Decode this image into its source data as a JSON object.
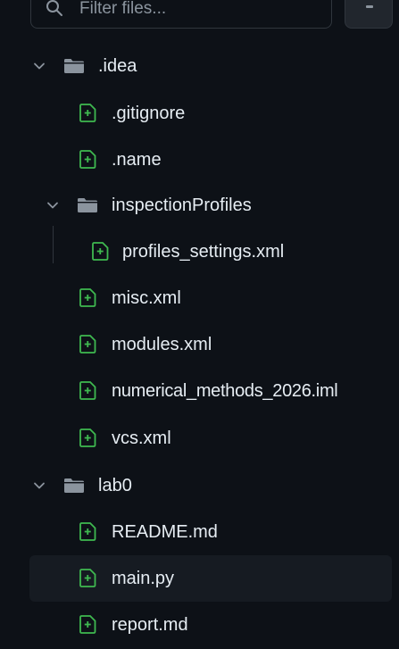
{
  "search": {
    "placeholder": "Filter files..."
  },
  "tree": [
    {
      "type": "folder",
      "label": ".idea",
      "expanded": true,
      "icon": "folder-icon"
    },
    {
      "type": "file",
      "label": ".gitignore",
      "icon": "file-added-icon"
    },
    {
      "type": "file",
      "label": ".name",
      "icon": "file-added-icon"
    },
    {
      "type": "folder",
      "label": "inspectionProfiles",
      "expanded": true,
      "icon": "folder-icon"
    },
    {
      "type": "file",
      "label": "profiles_settings.xml",
      "icon": "file-added-icon"
    },
    {
      "type": "file",
      "label": "misc.xml",
      "icon": "file-added-icon"
    },
    {
      "type": "file",
      "label": "modules.xml",
      "icon": "file-added-icon"
    },
    {
      "type": "file",
      "label": "numerical_methods_2026.iml",
      "icon": "file-added-icon"
    },
    {
      "type": "file",
      "label": "vcs.xml",
      "icon": "file-added-icon"
    },
    {
      "type": "folder",
      "label": "lab0",
      "expanded": true,
      "icon": "folder-icon"
    },
    {
      "type": "file",
      "label": "README.md",
      "icon": "file-added-icon"
    },
    {
      "type": "file",
      "label": "main.py",
      "icon": "file-added-icon",
      "selected": true
    },
    {
      "type": "file",
      "label": "report.md",
      "icon": "file-added-icon"
    }
  ],
  "colors": {
    "background": "#0d1117",
    "selected_row": "#161b22",
    "added_green": "#3fb950",
    "folder_gray": "#8b949e",
    "text": "#e6edf3"
  }
}
